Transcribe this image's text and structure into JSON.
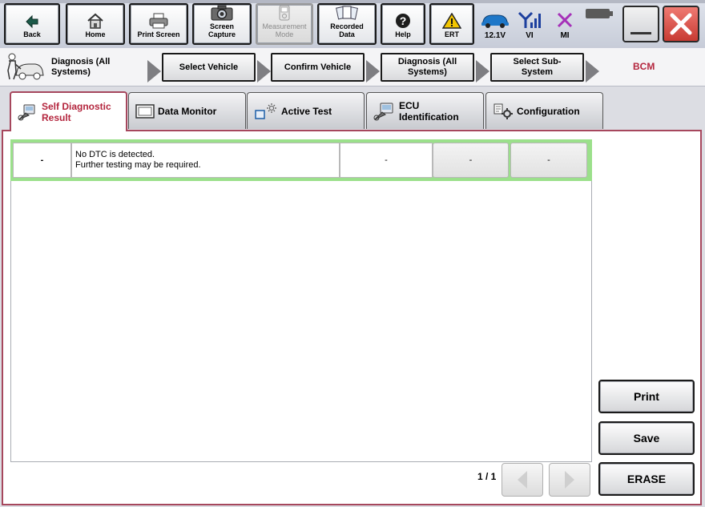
{
  "toolbar": {
    "back": "Back",
    "home": "Home",
    "print_screen": "Print Screen",
    "screen_capture_1": "Screen",
    "screen_capture_2": "Capture",
    "measurement_1": "Measurement",
    "measurement_2": "Mode",
    "recorded_1": "Recorded",
    "recorded_2": "Data",
    "help": "Help",
    "ert": "ERT"
  },
  "status": {
    "voltage": "12.1V",
    "vi": "VI",
    "mi": "MI"
  },
  "breadcrumb": {
    "current_1": "Diagnosis (All",
    "current_2": "Systems)",
    "step1": "Select Vehicle",
    "step2": "Confirm Vehicle",
    "step3_1": "Diagnosis (All",
    "step3_2": "Systems)",
    "step4_1": "Select Sub-",
    "step4_2": "System",
    "system": "BCM"
  },
  "tabs": {
    "self_diag_1": "Self Diagnostic",
    "self_diag_2": "Result",
    "data_monitor": "Data Monitor",
    "active_test": "Active Test",
    "ecu_1": "ECU",
    "ecu_2": "Identification",
    "configuration": "Configuration"
  },
  "dtc_row": {
    "code": "-",
    "message_1": "No DTC is detected.",
    "message_2": "Further testing may be required.",
    "col3": "-",
    "col4": "-",
    "col5": "-"
  },
  "pager": {
    "page": "1 / 1"
  },
  "actions": {
    "print": "Print",
    "save": "Save",
    "erase": "ERASE"
  },
  "colors": {
    "accent": "#a6475d",
    "tab_text": "#b4263e",
    "highlight": "#9be08b",
    "close_red": "#d9534f"
  }
}
